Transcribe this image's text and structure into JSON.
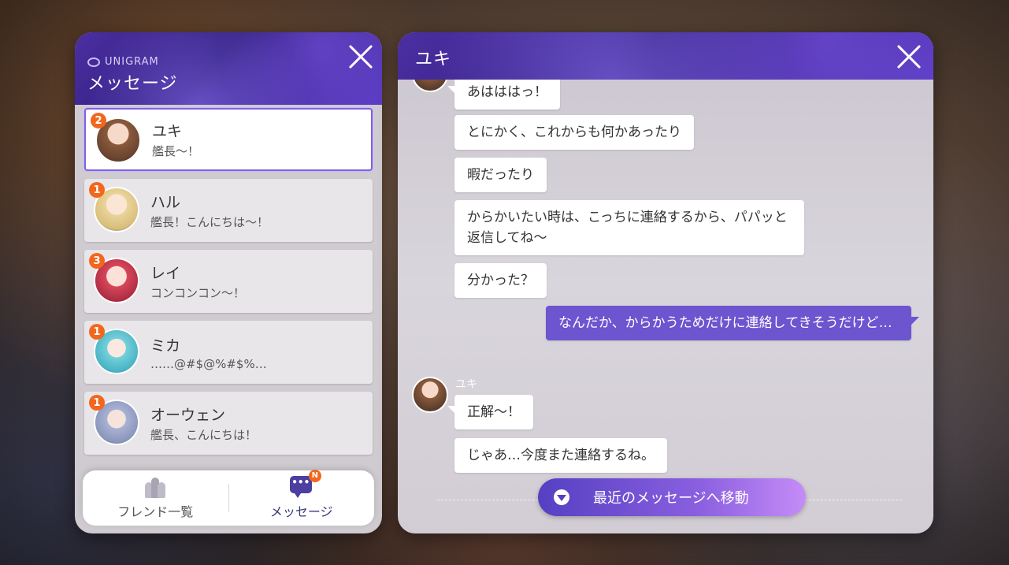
{
  "left_panel": {
    "brand": "UNIGRAM",
    "title": "メッセージ",
    "conversations": [
      {
        "name": "ユキ",
        "preview": "艦長〜！",
        "badge": "2",
        "avatar_color": "#8a5a3c"
      },
      {
        "name": "ハル",
        "preview": "艦長！こんにちは〜！",
        "badge": "1",
        "avatar_color": "#e8d39a"
      },
      {
        "name": "レイ",
        "preview": "コンコンコン〜！",
        "badge": "3",
        "avatar_color": "#c43a4a"
      },
      {
        "name": "ミカ",
        "preview": "……@#$@%#$%…",
        "badge": "1",
        "avatar_color": "#6cc8d4"
      },
      {
        "name": "オーウェン",
        "preview": "艦長、こんにちは！",
        "badge": "1",
        "avatar_color": "#9aa6c8"
      }
    ],
    "tabs": {
      "friends_label": "フレンド一覧",
      "messages_label": "メッセージ",
      "messages_badge": "N"
    }
  },
  "chat": {
    "title": "ユキ",
    "sender_name": "ユキ",
    "messages": [
      {
        "from": "them",
        "text": "あはははっ！"
      },
      {
        "from": "them",
        "text": "とにかく、これからも何かあったり"
      },
      {
        "from": "them",
        "text": "暇だったり"
      },
      {
        "from": "them",
        "text": "からかいたい時は、こっちに連絡するから、パパッと返信してね〜"
      },
      {
        "from": "them",
        "text": "分かった？"
      },
      {
        "from": "me",
        "text": "なんだか、からかうためだけに連絡してきそうだけど…"
      },
      {
        "from": "them",
        "text": "正解〜！"
      },
      {
        "from": "them",
        "text": "じゃあ…今度また連絡するね。"
      }
    ],
    "jump_button": "最近のメッセージへ移動"
  },
  "colors": {
    "accent": "#6c55cf",
    "badge": "#f2671d"
  }
}
